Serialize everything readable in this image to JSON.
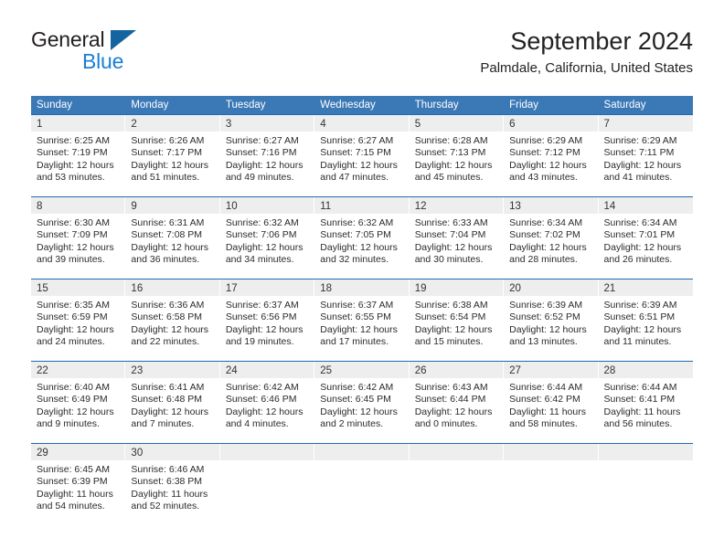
{
  "brand": {
    "name_top": "General",
    "name_bottom": "Blue",
    "accent_color": "#1a7fd4",
    "triangle_color": "#1464a0"
  },
  "header": {
    "title": "September 2024",
    "subtitle": "Palmdale, California, United States"
  },
  "theme": {
    "header_row_bg": "#3b78b6",
    "week_divider": "#1f6bb0",
    "daynum_band_bg": "#eeeeee"
  },
  "weekdays": [
    "Sunday",
    "Monday",
    "Tuesday",
    "Wednesday",
    "Thursday",
    "Friday",
    "Saturday"
  ],
  "weeks": [
    [
      {
        "day": "1",
        "sunrise": "Sunrise: 6:25 AM",
        "sunset": "Sunset: 7:19 PM",
        "daylight1": "Daylight: 12 hours",
        "daylight2": "and 53 minutes."
      },
      {
        "day": "2",
        "sunrise": "Sunrise: 6:26 AM",
        "sunset": "Sunset: 7:17 PM",
        "daylight1": "Daylight: 12 hours",
        "daylight2": "and 51 minutes."
      },
      {
        "day": "3",
        "sunrise": "Sunrise: 6:27 AM",
        "sunset": "Sunset: 7:16 PM",
        "daylight1": "Daylight: 12 hours",
        "daylight2": "and 49 minutes."
      },
      {
        "day": "4",
        "sunrise": "Sunrise: 6:27 AM",
        "sunset": "Sunset: 7:15 PM",
        "daylight1": "Daylight: 12 hours",
        "daylight2": "and 47 minutes."
      },
      {
        "day": "5",
        "sunrise": "Sunrise: 6:28 AM",
        "sunset": "Sunset: 7:13 PM",
        "daylight1": "Daylight: 12 hours",
        "daylight2": "and 45 minutes."
      },
      {
        "day": "6",
        "sunrise": "Sunrise: 6:29 AM",
        "sunset": "Sunset: 7:12 PM",
        "daylight1": "Daylight: 12 hours",
        "daylight2": "and 43 minutes."
      },
      {
        "day": "7",
        "sunrise": "Sunrise: 6:29 AM",
        "sunset": "Sunset: 7:11 PM",
        "daylight1": "Daylight: 12 hours",
        "daylight2": "and 41 minutes."
      }
    ],
    [
      {
        "day": "8",
        "sunrise": "Sunrise: 6:30 AM",
        "sunset": "Sunset: 7:09 PM",
        "daylight1": "Daylight: 12 hours",
        "daylight2": "and 39 minutes."
      },
      {
        "day": "9",
        "sunrise": "Sunrise: 6:31 AM",
        "sunset": "Sunset: 7:08 PM",
        "daylight1": "Daylight: 12 hours",
        "daylight2": "and 36 minutes."
      },
      {
        "day": "10",
        "sunrise": "Sunrise: 6:32 AM",
        "sunset": "Sunset: 7:06 PM",
        "daylight1": "Daylight: 12 hours",
        "daylight2": "and 34 minutes."
      },
      {
        "day": "11",
        "sunrise": "Sunrise: 6:32 AM",
        "sunset": "Sunset: 7:05 PM",
        "daylight1": "Daylight: 12 hours",
        "daylight2": "and 32 minutes."
      },
      {
        "day": "12",
        "sunrise": "Sunrise: 6:33 AM",
        "sunset": "Sunset: 7:04 PM",
        "daylight1": "Daylight: 12 hours",
        "daylight2": "and 30 minutes."
      },
      {
        "day": "13",
        "sunrise": "Sunrise: 6:34 AM",
        "sunset": "Sunset: 7:02 PM",
        "daylight1": "Daylight: 12 hours",
        "daylight2": "and 28 minutes."
      },
      {
        "day": "14",
        "sunrise": "Sunrise: 6:34 AM",
        "sunset": "Sunset: 7:01 PM",
        "daylight1": "Daylight: 12 hours",
        "daylight2": "and 26 minutes."
      }
    ],
    [
      {
        "day": "15",
        "sunrise": "Sunrise: 6:35 AM",
        "sunset": "Sunset: 6:59 PM",
        "daylight1": "Daylight: 12 hours",
        "daylight2": "and 24 minutes."
      },
      {
        "day": "16",
        "sunrise": "Sunrise: 6:36 AM",
        "sunset": "Sunset: 6:58 PM",
        "daylight1": "Daylight: 12 hours",
        "daylight2": "and 22 minutes."
      },
      {
        "day": "17",
        "sunrise": "Sunrise: 6:37 AM",
        "sunset": "Sunset: 6:56 PM",
        "daylight1": "Daylight: 12 hours",
        "daylight2": "and 19 minutes."
      },
      {
        "day": "18",
        "sunrise": "Sunrise: 6:37 AM",
        "sunset": "Sunset: 6:55 PM",
        "daylight1": "Daylight: 12 hours",
        "daylight2": "and 17 minutes."
      },
      {
        "day": "19",
        "sunrise": "Sunrise: 6:38 AM",
        "sunset": "Sunset: 6:54 PM",
        "daylight1": "Daylight: 12 hours",
        "daylight2": "and 15 minutes."
      },
      {
        "day": "20",
        "sunrise": "Sunrise: 6:39 AM",
        "sunset": "Sunset: 6:52 PM",
        "daylight1": "Daylight: 12 hours",
        "daylight2": "and 13 minutes."
      },
      {
        "day": "21",
        "sunrise": "Sunrise: 6:39 AM",
        "sunset": "Sunset: 6:51 PM",
        "daylight1": "Daylight: 12 hours",
        "daylight2": "and 11 minutes."
      }
    ],
    [
      {
        "day": "22",
        "sunrise": "Sunrise: 6:40 AM",
        "sunset": "Sunset: 6:49 PM",
        "daylight1": "Daylight: 12 hours",
        "daylight2": "and 9 minutes."
      },
      {
        "day": "23",
        "sunrise": "Sunrise: 6:41 AM",
        "sunset": "Sunset: 6:48 PM",
        "daylight1": "Daylight: 12 hours",
        "daylight2": "and 7 minutes."
      },
      {
        "day": "24",
        "sunrise": "Sunrise: 6:42 AM",
        "sunset": "Sunset: 6:46 PM",
        "daylight1": "Daylight: 12 hours",
        "daylight2": "and 4 minutes."
      },
      {
        "day": "25",
        "sunrise": "Sunrise: 6:42 AM",
        "sunset": "Sunset: 6:45 PM",
        "daylight1": "Daylight: 12 hours",
        "daylight2": "and 2 minutes."
      },
      {
        "day": "26",
        "sunrise": "Sunrise: 6:43 AM",
        "sunset": "Sunset: 6:44 PM",
        "daylight1": "Daylight: 12 hours",
        "daylight2": "and 0 minutes."
      },
      {
        "day": "27",
        "sunrise": "Sunrise: 6:44 AM",
        "sunset": "Sunset: 6:42 PM",
        "daylight1": "Daylight: 11 hours",
        "daylight2": "and 58 minutes."
      },
      {
        "day": "28",
        "sunrise": "Sunrise: 6:44 AM",
        "sunset": "Sunset: 6:41 PM",
        "daylight1": "Daylight: 11 hours",
        "daylight2": "and 56 minutes."
      }
    ],
    [
      {
        "day": "29",
        "sunrise": "Sunrise: 6:45 AM",
        "sunset": "Sunset: 6:39 PM",
        "daylight1": "Daylight: 11 hours",
        "daylight2": "and 54 minutes."
      },
      {
        "day": "30",
        "sunrise": "Sunrise: 6:46 AM",
        "sunset": "Sunset: 6:38 PM",
        "daylight1": "Daylight: 11 hours",
        "daylight2": "and 52 minutes."
      },
      {
        "day": "",
        "sunrise": "",
        "sunset": "",
        "daylight1": "",
        "daylight2": ""
      },
      {
        "day": "",
        "sunrise": "",
        "sunset": "",
        "daylight1": "",
        "daylight2": ""
      },
      {
        "day": "",
        "sunrise": "",
        "sunset": "",
        "daylight1": "",
        "daylight2": ""
      },
      {
        "day": "",
        "sunrise": "",
        "sunset": "",
        "daylight1": "",
        "daylight2": ""
      },
      {
        "day": "",
        "sunrise": "",
        "sunset": "",
        "daylight1": "",
        "daylight2": ""
      }
    ]
  ]
}
